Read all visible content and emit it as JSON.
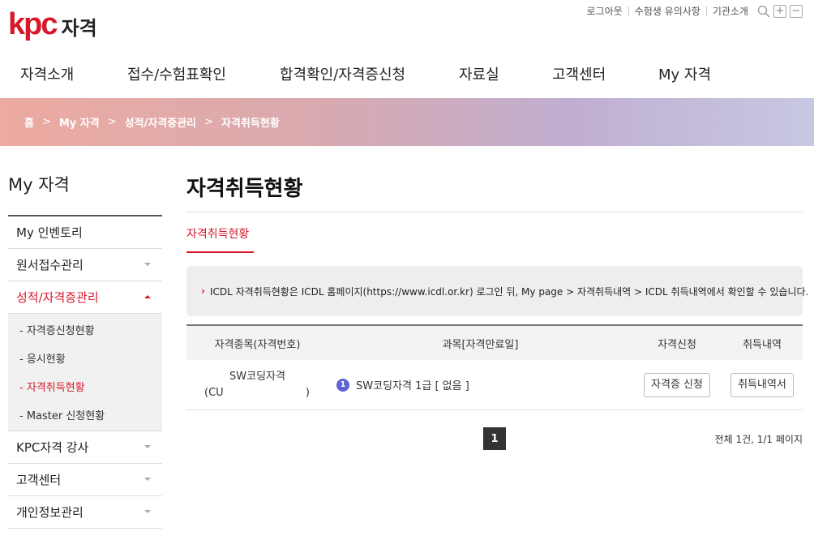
{
  "header": {
    "logo_mark": "kpc",
    "logo_text": "자격",
    "util_links": [
      "로그아웃",
      "수험생 유의사항",
      "기관소개"
    ],
    "icons": [
      "search-icon",
      "zoom-in-icon",
      "zoom-out-icon"
    ]
  },
  "gnb": [
    "자격소개",
    "접수/수험표확인",
    "합격확인/자격증신청",
    "자료실",
    "고객센터",
    "My 자격"
  ],
  "breadcrumb": [
    "홈",
    "My 자격",
    "성적/자격증관리",
    "자격취득현황"
  ],
  "sidebar": {
    "title": "My 자격",
    "items": [
      {
        "label": "My 인벤토리"
      },
      {
        "label": "원서접수관리"
      },
      {
        "label": "성적/자격증관리"
      },
      {
        "label": "KPC자격 강사"
      },
      {
        "label": "고객센터"
      },
      {
        "label": "개인정보관리"
      }
    ],
    "submenu": [
      "- 자격증신청현황",
      "- 응시현황",
      "- 자격취득현황",
      "- Master 신청현황"
    ]
  },
  "content": {
    "title": "자격취득현황",
    "tab": "자격취득현황",
    "notice": "ICDL 자격취득현황은 ICDL 홈페이지(https://www.icdl.or.kr) 로그인 뒤, My page > 자격취득내역 > ICDL 취득내역에서 확인할 수 있습니다."
  },
  "table": {
    "headers": [
      "자격종목(자격번호)",
      "과목[자격만료일]",
      "자격신청",
      "취득내역"
    ],
    "rows": [
      {
        "name": "SW코딩자격",
        "code_open": "(CU",
        "code_close": ")",
        "badge": "1",
        "subject": "SW코딩자격 1급 [ 없음 ]",
        "apply_btn": "자격증 신청",
        "history_btn": "취득내역서"
      }
    ]
  },
  "pagination": {
    "current": "1",
    "summary": "전체 1건, 1/1 페이지"
  },
  "colors": {
    "accent": "#d7182a",
    "badge": "#5b63d6"
  }
}
